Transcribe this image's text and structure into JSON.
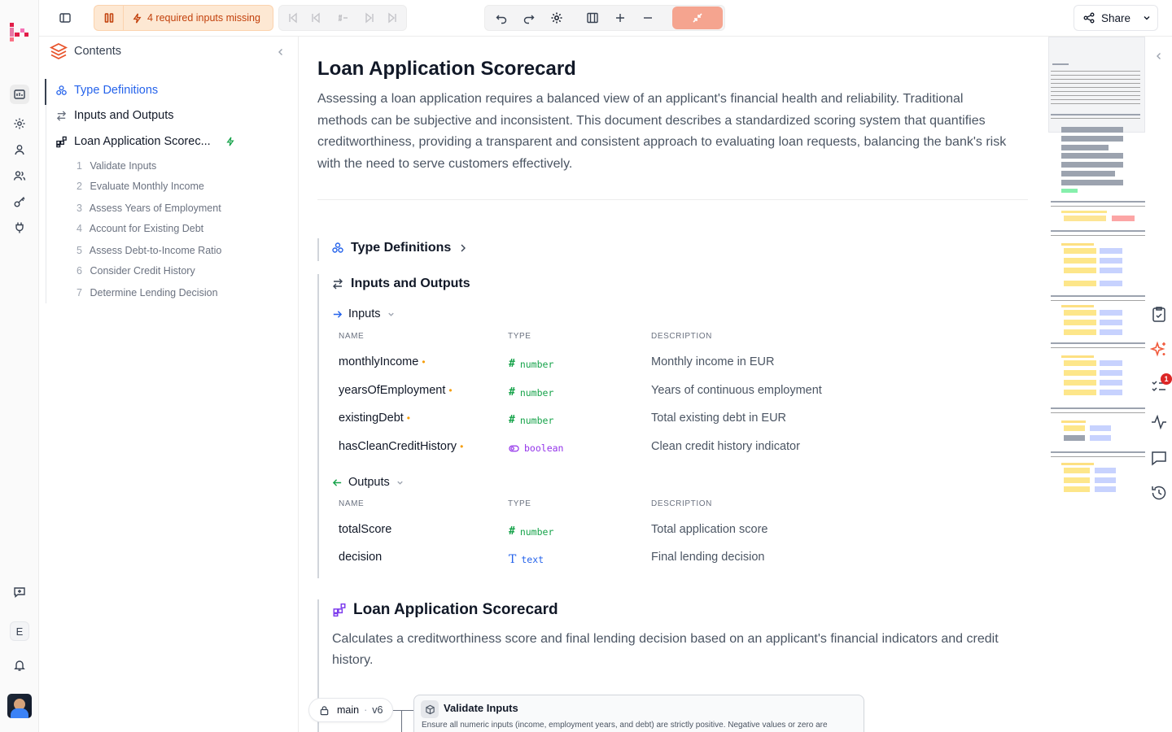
{
  "topbar": {
    "warning": "4 required inputs missing",
    "share_label": "Share"
  },
  "sidebar": {
    "title": "Contents",
    "items": [
      {
        "label": "Type Definitions"
      },
      {
        "label": "Inputs and Outputs"
      },
      {
        "label": "Loan Application Scorec..."
      }
    ],
    "steps": [
      {
        "num": "1",
        "label": "Validate Inputs"
      },
      {
        "num": "2",
        "label": "Evaluate Monthly Income"
      },
      {
        "num": "3",
        "label": "Assess Years of Employment"
      },
      {
        "num": "4",
        "label": "Account for Existing Debt"
      },
      {
        "num": "5",
        "label": "Assess Debt-to-Income Ratio"
      },
      {
        "num": "6",
        "label": "Consider Credit History"
      },
      {
        "num": "7",
        "label": "Determine Lending Decision"
      }
    ]
  },
  "rail": {
    "user_initial": "E"
  },
  "doc": {
    "title": "Loan Application Scorecard",
    "intro": "Assessing a loan application requires a balanced view of an applicant's financial health and reliability. Traditional methods can be subjective and inconsistent. This document describes a standardized scoring system that quantifies creditworthiness, providing a transparent and consistent approach to evaluating loan requests, balancing the bank's risk with the need to serve customers effectively.",
    "type_defs_label": "Type Definitions",
    "io_label": "Inputs and Outputs",
    "inputs_label": "Inputs",
    "outputs_label": "Outputs",
    "col_name": "NAME",
    "col_type": "TYPE",
    "col_desc": "DESCRIPTION",
    "inputs": [
      {
        "name": "monthlyIncome",
        "type": "number",
        "desc": "Monthly income in EUR"
      },
      {
        "name": "yearsOfEmployment",
        "type": "number",
        "desc": "Years of continuous employment"
      },
      {
        "name": "existingDebt",
        "type": "number",
        "desc": "Total existing debt in EUR"
      },
      {
        "name": "hasCleanCreditHistory",
        "type": "boolean",
        "desc": "Clean credit history indicator"
      }
    ],
    "outputs": [
      {
        "name": "totalScore",
        "type": "number",
        "desc": "Total application score"
      },
      {
        "name": "decision",
        "type": "text",
        "desc": "Final lending decision"
      }
    ],
    "section_title": "Loan Application Scorecard",
    "section_desc": "Calculates a creditworthiness score and final lending decision based on an applicant's financial indicators and credit history.",
    "branch": "main",
    "version": "v6",
    "step_title": "Validate Inputs",
    "step_desc": "Ensure all numeric inputs (income, employment years, and debt) are strictly positive. Negative values or zero are"
  },
  "rightrail": {
    "badge": "1"
  },
  "colors": {
    "accent": "#2563eb",
    "warning_bg": "#fde8d3",
    "warning_text": "#c2410c",
    "number": "#16a34a",
    "boolean": "#9333ea",
    "text_type": "#2563eb",
    "brand": "#e11d48"
  }
}
